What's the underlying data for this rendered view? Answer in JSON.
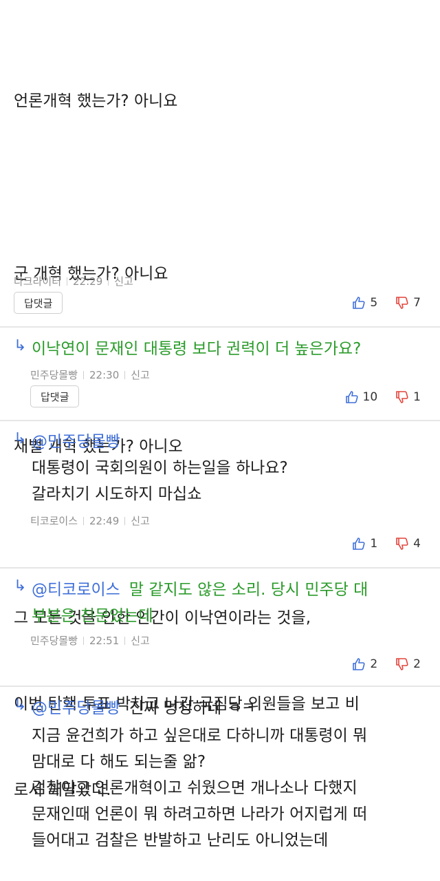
{
  "comment1": {
    "lines": [
      "언론개혁 했는가? 아니요",
      "",
      "군 개혁 했는가? 아니요",
      "",
      "재벌 개혁 했는가? 아니오",
      "",
      "그 모든 것을 안한 인간이 이낙연이라는 것을,",
      "이번 탄핵 투표 박차고 나간 국짐당 의원들을 보고 비",
      "로서 깨달았다."
    ],
    "author": "다크라이터",
    "time": "22:29",
    "report": "신고",
    "reply_label": "답댓글",
    "up": "5",
    "down": "7"
  },
  "reply1": {
    "arrow": "↳",
    "text": "이낙연이 문재인 대통령 보다 권력이 더 높은가요?",
    "author": "민주당몰빵",
    "time": "22:30",
    "report": "신고",
    "reply_label": "답댓글",
    "up": "10",
    "down": "1"
  },
  "reply2": {
    "arrow": "↳",
    "mention": "@민주당몰빵",
    "line1": "대통령이 국회의원이 하는일을 하나요?",
    "line2": "갈라치기 시도하지 마십쇼",
    "author": "티코로이스",
    "time": "22:49",
    "report": "신고",
    "up": "1",
    "down": "4"
  },
  "reply3": {
    "arrow": "↳",
    "mention": "@티코로이스",
    "text1": "말 같지도 않은 소리. 당시 민주당 대",
    "text2": "부분은 친문었는데",
    "author": "민주당몰빵",
    "time": "22:51",
    "report": "신고",
    "up": "2",
    "down": "2"
  },
  "reply4": {
    "arrow": "↳",
    "mention": "@민주당몰빵",
    "first": "진짜 멍청하네 ㅋㅋ",
    "lines": [
      "지금 윤건희가 하고 싶은대로 다하니까 대통령이 뭐",
      "맘대로 다 해도 되는줄 앎?",
      "검찰이고 언론개혁이고 쉬웠으면 개나소나 다했지",
      "문재인때 언론이 뭐 하려고하면 나라가 어지럽게 떠",
      "들어대고 검찰은 반발하고 난리도 아니었는데"
    ]
  },
  "colors": {
    "accent": "#3f6fd8",
    "down": "#e2433a",
    "green": "#2a9b2a"
  },
  "icons": {
    "up": "thumbs-up-icon",
    "down": "thumbs-down-icon",
    "reply": "reply-arrow-icon"
  }
}
